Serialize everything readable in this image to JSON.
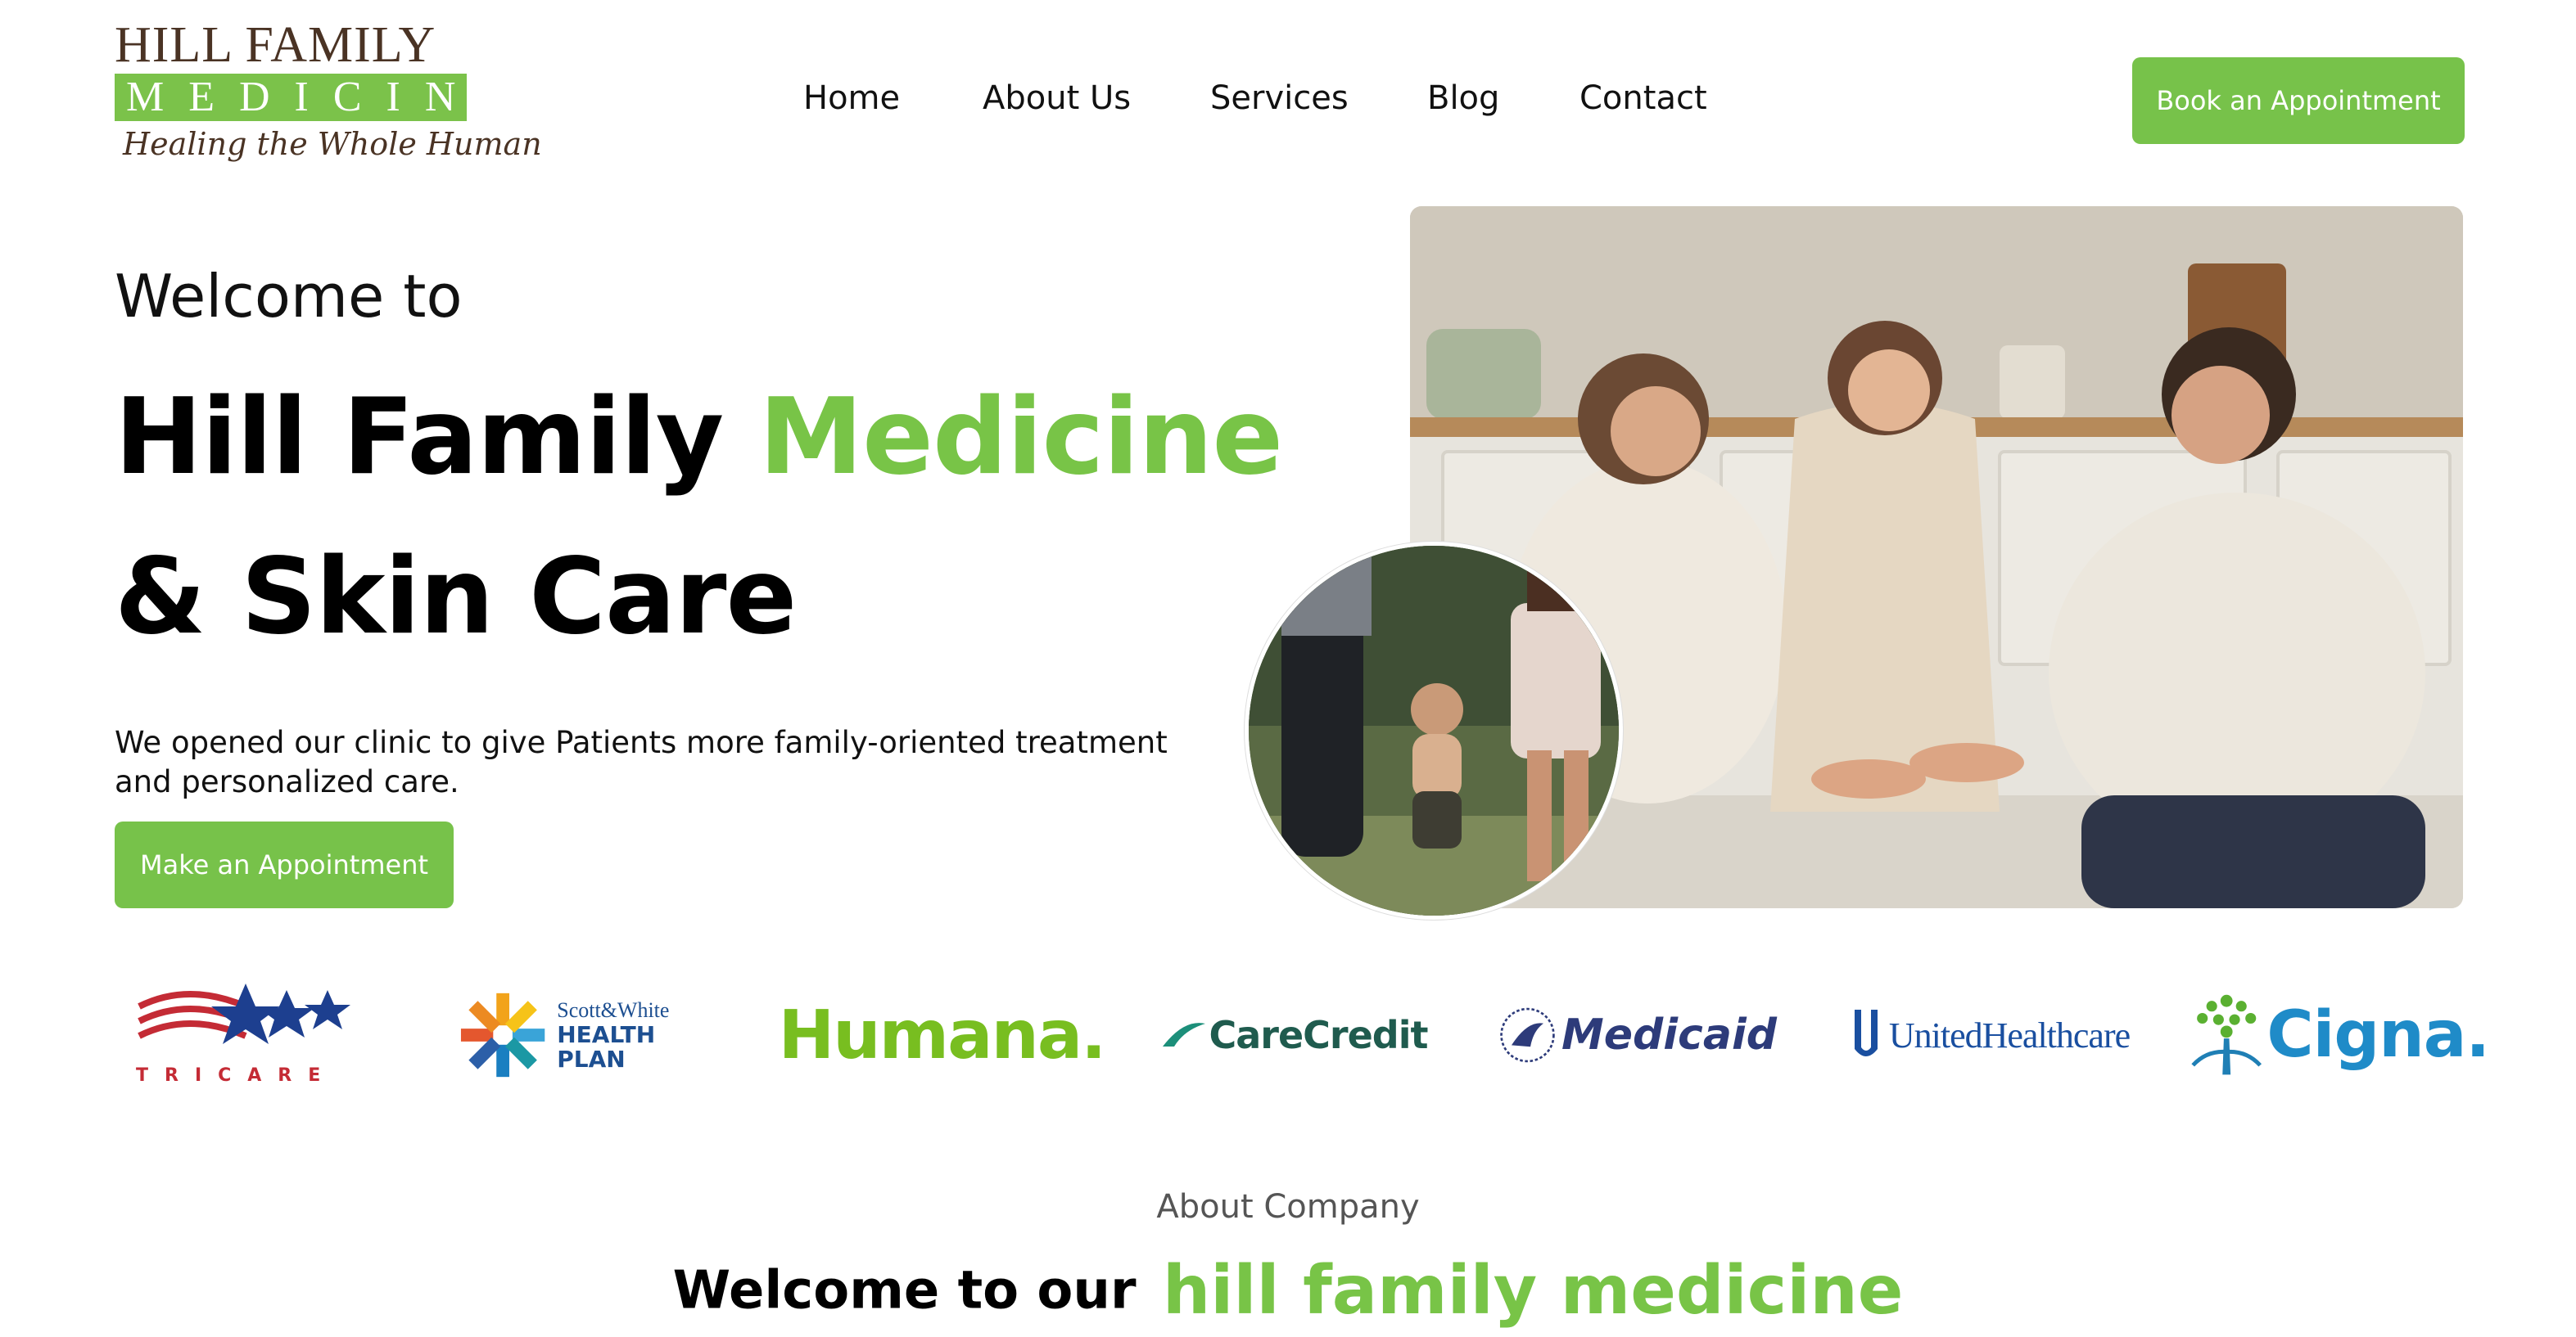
{
  "header": {
    "logo": {
      "line1": "HILL FAMILY",
      "line2": "MEDICINE",
      "tagline": "Healing the Whole Human"
    },
    "nav": [
      {
        "label": "Home"
      },
      {
        "label": "About Us"
      },
      {
        "label": "Services"
      },
      {
        "label": "Blog"
      },
      {
        "label": "Contact"
      }
    ],
    "cta_label": "Book an Appointment"
  },
  "hero": {
    "welcome": "Welcome to",
    "title_part1": "Hill Family",
    "title_accent": "Medicine",
    "title_part2": "& Skin Care",
    "description": "We opened our clinic to give Patients more family-oriented treatment and personalized care.",
    "cta_label": "Make an Appointment",
    "images": {
      "main_photo": "family-kitchen-photo",
      "circle_photo": "family-walking-photo"
    }
  },
  "insurers": [
    {
      "name": "TRICARE"
    },
    {
      "name_line1": "Scott&White",
      "name_line2": "HEALTH PLAN"
    },
    {
      "name": "Humana."
    },
    {
      "name": "CareCredit"
    },
    {
      "name": "Medicaid"
    },
    {
      "name": "UnitedHealthcare"
    },
    {
      "name": "Cigna."
    }
  ],
  "about": {
    "label": "About Company",
    "title_bold": "Welcome to our",
    "title_accent": "hill family medicine"
  },
  "colors": {
    "brand_green": "#77c24a",
    "logo_brown": "#4a3324",
    "text": "#111111"
  }
}
